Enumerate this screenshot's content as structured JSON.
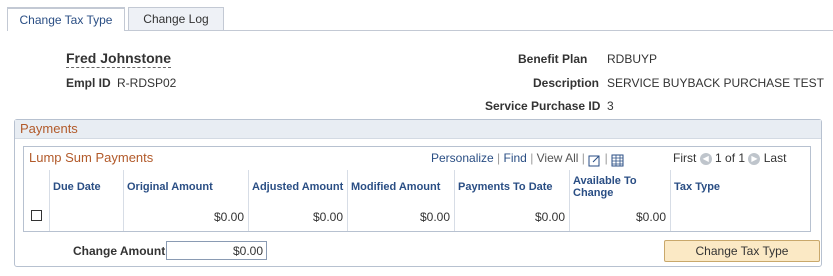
{
  "tabs": [
    {
      "label": "Change Tax Type"
    },
    {
      "label": "Change Log"
    }
  ],
  "employee": {
    "name": "Fred Johnstone",
    "empl_id_label": "Empl ID",
    "empl_id": "R-RDSP02"
  },
  "plan": {
    "benefit_plan_label": "Benefit Plan",
    "benefit_plan": "RDBUYP",
    "description_label": "Description",
    "description": "SERVICE BUYBACK PURCHASE TEST",
    "service_purchase_id_label": "Service Purchase ID",
    "service_purchase_id": "3"
  },
  "payments": {
    "title": "Payments",
    "grid": {
      "title": "Lump Sum Payments",
      "nav": {
        "personalize": "Personalize",
        "find": "Find",
        "view_all": "View All",
        "first": "First",
        "range": "1 of 1",
        "last": "Last"
      },
      "columns": [
        "Due Date",
        "Original Amount",
        "Adjusted Amount",
        "Modified Amount",
        "Payments To Date",
        "Available To Change",
        "Tax Type"
      ],
      "rows": [
        {
          "due_date": "",
          "original_amount": "$0.00",
          "adjusted_amount": "$0.00",
          "modified_amount": "$0.00",
          "payments_to_date": "$0.00",
          "available_to_change": "$0.00",
          "tax_type": ""
        }
      ]
    },
    "change_amount_label": "Change Amount",
    "change_amount_value": "$0.00",
    "button_label": "Change Tax Type"
  },
  "colors": {
    "link": "#2a4e84",
    "section_title": "#b25a2a",
    "button_bg": "#fbe9c5"
  }
}
